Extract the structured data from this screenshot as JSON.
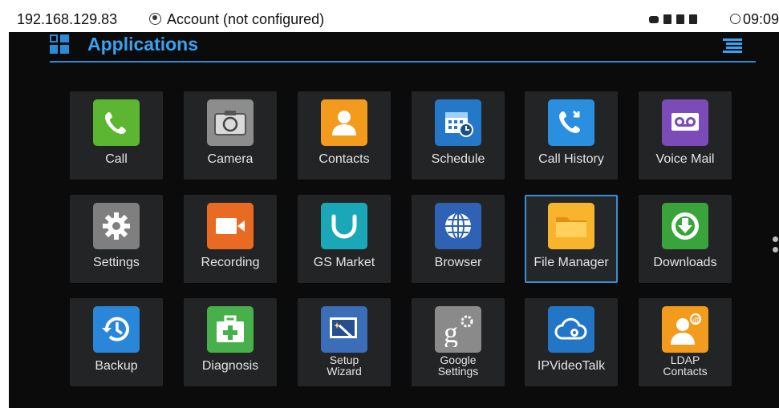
{
  "status_bar": {
    "ip": "192.168.129.83",
    "account": "Account (not configured)",
    "time": "09:09"
  },
  "header": {
    "title": "Applications"
  },
  "apps": [
    {
      "label": "Call",
      "icon": "phone-icon",
      "color": "#5cb632"
    },
    {
      "label": "Camera",
      "icon": "camera-icon",
      "color": "#8d8d8d"
    },
    {
      "label": "Contacts",
      "icon": "contact-person-icon",
      "color": "#f29b1d"
    },
    {
      "label": "Schedule",
      "icon": "calendar-icon",
      "color": "#2577c8"
    },
    {
      "label": "Call History",
      "icon": "call-history-icon",
      "color": "#2b8fe0"
    },
    {
      "label": "Voice Mail",
      "icon": "voicemail-icon",
      "color": "#7b4bb8"
    },
    {
      "label": "Settings",
      "icon": "gear-icon",
      "color": "#7f7f7f"
    },
    {
      "label": "Recording",
      "icon": "video-camera-icon",
      "color": "#e86a23"
    },
    {
      "label": "GS Market",
      "icon": "market-bag-icon",
      "color": "#1aa7b8"
    },
    {
      "label": "Browser",
      "icon": "globe-icon",
      "color": "#2f62b4"
    },
    {
      "label": "File Manager",
      "icon": "folder-icon",
      "color": "#f7b42c"
    },
    {
      "label": "Downloads",
      "icon": "download-icon",
      "color": "#3aa43c"
    },
    {
      "label": "Backup",
      "icon": "backup-clock-icon",
      "color": "#2a86d8"
    },
    {
      "label": "Diagnosis",
      "icon": "first-aid-kit-icon",
      "color": "#48b04a"
    },
    {
      "label": "Setup\nWizard",
      "icon": "wizard-icon",
      "color": "#3b6db8"
    },
    {
      "label": "Google\nSettings",
      "icon": "google-settings-icon",
      "color": "#8a8a8a"
    },
    {
      "label": "IPVideoTalk",
      "icon": "cloud-camera-icon",
      "color": "#2276c5"
    },
    {
      "label": "LDAP\nContacts",
      "icon": "ldap-contact-icon",
      "color": "#f29b1d"
    }
  ],
  "selected_app": "File Manager"
}
